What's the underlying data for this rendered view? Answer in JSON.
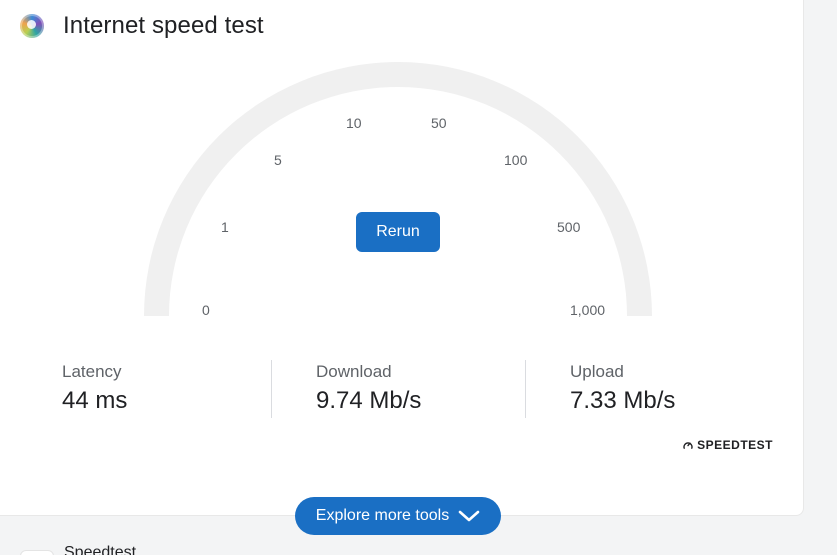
{
  "header": {
    "title": "Internet speed test",
    "logo_icon": "speedtest-globe-icon"
  },
  "gauge": {
    "ticks": [
      {
        "label": "0"
      },
      {
        "label": "1"
      },
      {
        "label": "5"
      },
      {
        "label": "10"
      },
      {
        "label": "50"
      },
      {
        "label": "100"
      },
      {
        "label": "500"
      },
      {
        "label": "1,000"
      }
    ],
    "rerun_label": "Rerun"
  },
  "stats": {
    "latency": {
      "label": "Latency",
      "value": "44 ms"
    },
    "download": {
      "label": "Download",
      "value": "9.74 Mb/s"
    },
    "upload": {
      "label": "Upload",
      "value": "7.33 Mb/s"
    }
  },
  "brand": {
    "text": "SPEEDTEST",
    "icon": "gauge-icon"
  },
  "explore": {
    "label": "Explore more tools",
    "icon": "chevron-down-icon"
  },
  "next_result": {
    "title": "Speedtest"
  },
  "colors": {
    "accent": "#1a6fc4",
    "gauge_track": "#f0f0f0",
    "muted_text": "#5f6368",
    "primary_text": "#202124"
  }
}
